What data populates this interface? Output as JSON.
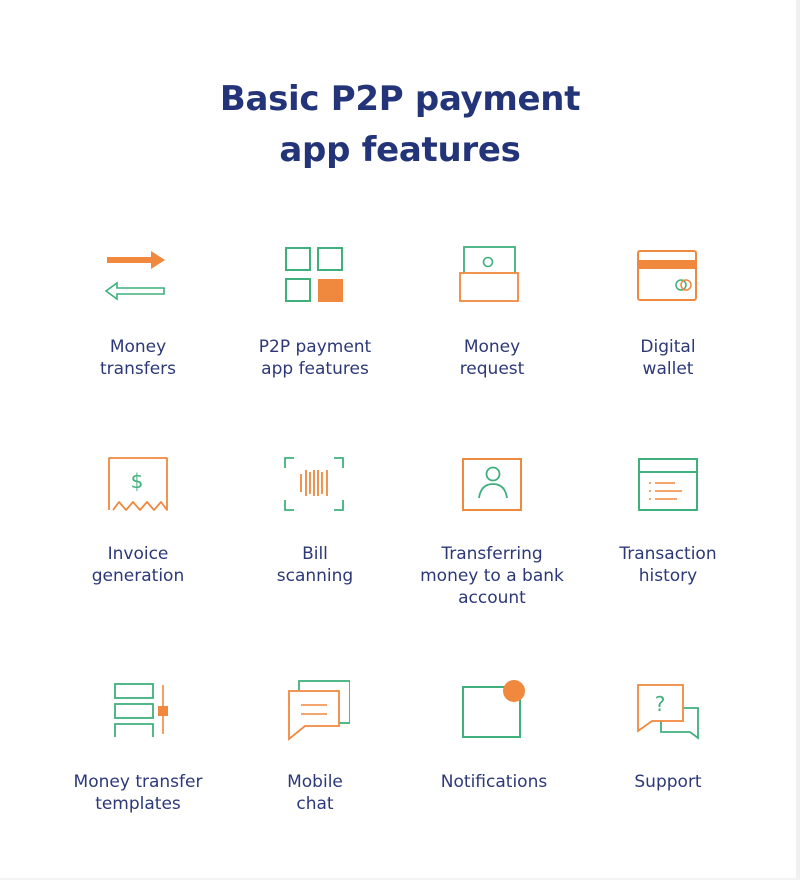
{
  "title": {
    "line1": "Basic P2P payment",
    "line2": "app features"
  },
  "colors": {
    "orange": "#f0883e",
    "green": "#3fb07c",
    "navy": "#243479"
  },
  "features": [
    {
      "icon": "arrows-exchange-icon",
      "lines": [
        "Money",
        "transfers"
      ]
    },
    {
      "icon": "grid-squares-icon",
      "lines": [
        "P2P payment",
        "app features"
      ]
    },
    {
      "icon": "money-envelope-icon",
      "lines": [
        "Money",
        "request"
      ]
    },
    {
      "icon": "credit-card-icon",
      "lines": [
        "Digital",
        "wallet"
      ]
    },
    {
      "icon": "invoice-receipt-icon",
      "lines": [
        "Invoice",
        "generation"
      ]
    },
    {
      "icon": "barcode-scan-icon",
      "lines": [
        "Bill",
        "scanning"
      ]
    },
    {
      "icon": "user-profile-icon",
      "lines": [
        "Transferring",
        "money to a bank",
        "account"
      ]
    },
    {
      "icon": "history-list-icon",
      "lines": [
        "Transaction",
        "history"
      ]
    },
    {
      "icon": "templates-slider-icon",
      "lines": [
        "Money transfer",
        "templates"
      ]
    },
    {
      "icon": "chat-bubbles-icon",
      "lines": [
        "Mobile",
        "chat"
      ]
    },
    {
      "icon": "notification-badge-icon",
      "lines": [
        "Notifications"
      ]
    },
    {
      "icon": "support-question-icon",
      "lines": [
        "Support"
      ]
    }
  ]
}
